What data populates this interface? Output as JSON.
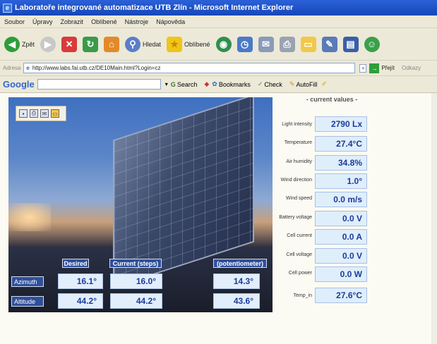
{
  "window": {
    "title": "Laboratoře integrované automatizace UTB Zlín - Microsoft Internet Explorer"
  },
  "menu": [
    "Soubor",
    "Úpravy",
    "Zobrazit",
    "Oblíbené",
    "Nástroje",
    "Nápověda"
  ],
  "toolbar": {
    "back": "Zpět",
    "search": "Hledat",
    "favorites": "Oblíbené"
  },
  "address": {
    "label": "Adresa",
    "url": "http://www.labs.fai.utb.cz/DE10Main.html?Login=cz",
    "go": "Přejít",
    "links": "Odkazy"
  },
  "google": {
    "logo": "Google",
    "search": "Search",
    "bookmarks": "Bookmarks",
    "check": "Check",
    "autofill": "AutoFill"
  },
  "control": {
    "headers": {
      "desired": "Desired",
      "current": "Current (steps)",
      "potentiometer": "(potentiometer)"
    },
    "rows": [
      {
        "label": "Azimuth",
        "desired": "16.1°",
        "current": "16.0°",
        "pot": "14.3°"
      },
      {
        "label": "Altitude",
        "desired": "44.2°",
        "current": "44.2°",
        "pot": "43.6°"
      }
    ]
  },
  "current_values": {
    "title": "- current values -",
    "items": [
      {
        "label": "Light intensity",
        "value": "2790 Lx"
      },
      {
        "label": "Temperature",
        "value": "27.4°C"
      },
      {
        "label": "Air humidity",
        "value": "34.8%"
      },
      {
        "label": "Wind direction",
        "value": "1.0°"
      },
      {
        "label": "Wind speed",
        "value": "0.0 m/s"
      },
      {
        "label": "Battery voltage",
        "value": "0.0 V"
      },
      {
        "label": "Cell current",
        "value": "0.0 A"
      },
      {
        "label": "Cell voltage",
        "value": "0.0 V"
      },
      {
        "label": "Cell power",
        "value": "0.0 W"
      },
      {
        "label": "Temp_in",
        "value": "27.6°C"
      }
    ]
  }
}
